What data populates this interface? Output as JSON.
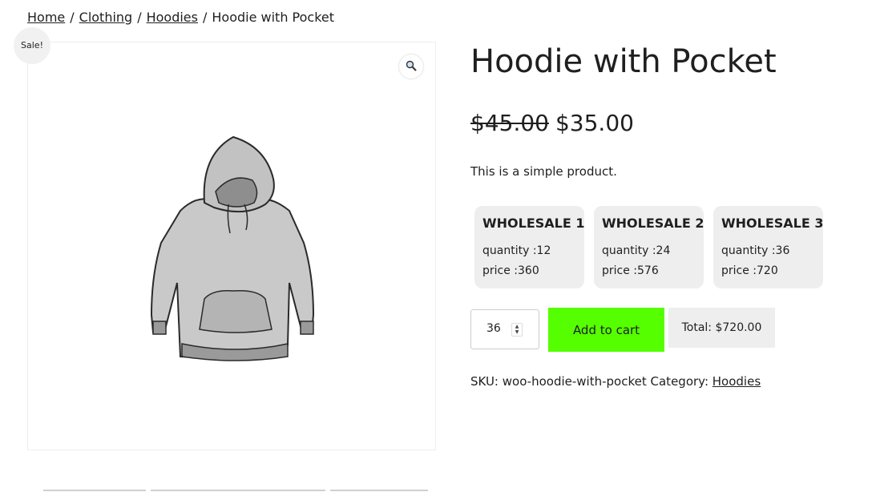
{
  "breadcrumb": {
    "items": [
      "Home",
      "Clothing",
      "Hoodies"
    ],
    "separator": "/",
    "current": "Hoodie with Pocket"
  },
  "badge": {
    "sale": "Sale!"
  },
  "gallery": {
    "zoom_icon": "magnifier-icon",
    "image": "hoodie-illustration"
  },
  "product": {
    "title": "Hoodie with Pocket",
    "old_price": "$45.00",
    "new_price": "$35.00",
    "description": "This is a simple product."
  },
  "wholesale": [
    {
      "title": "WHOLESALE 1",
      "quantity": "quantity :12",
      "price": "price :360"
    },
    {
      "title": "WHOLESALE 2",
      "quantity": "quantity :24",
      "price": "price :576"
    },
    {
      "title": "WHOLESALE 3",
      "quantity": "quantity :36",
      "price": "price :720"
    }
  ],
  "cart": {
    "quantity": "36",
    "add_label": "Add to cart",
    "total": "Total: $720.00"
  },
  "meta": {
    "sku_label": "SKU:",
    "sku": "woo-hoodie-with-pocket",
    "category_label": "Category:",
    "category": "Hoodies"
  },
  "colors": {
    "add_to_cart": "#55ff00",
    "card_bg": "#eeeeee",
    "text": "#1f1f1f"
  }
}
